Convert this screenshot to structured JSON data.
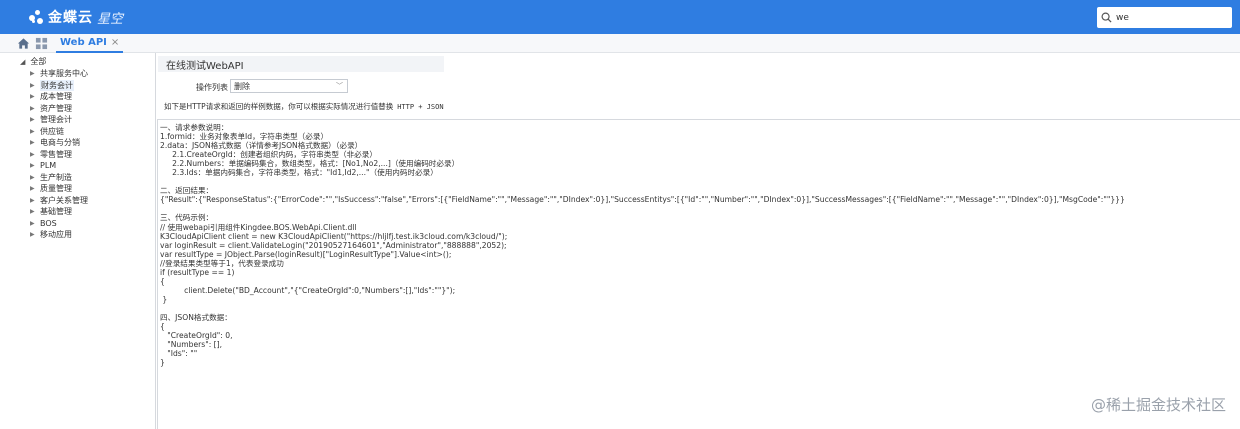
{
  "header": {
    "brand_name": "金蝶云",
    "brand_product": "星空",
    "search": {
      "value": "we"
    }
  },
  "tabs": [
    {
      "label": "Web API",
      "close": "×"
    }
  ],
  "sidebar": {
    "root": "全部",
    "items": [
      "共享服务中心",
      "财务会计",
      "成本管理",
      "资产管理",
      "管理会计",
      "供应链",
      "电商与分销",
      "零售管理",
      "PLM",
      "生产制造",
      "质量管理",
      "客户关系管理",
      "基础管理",
      "BOS",
      "移动应用"
    ],
    "selected_index": 1
  },
  "main": {
    "panel_title": "在线测试WebAPI",
    "operation_label": "操作列表",
    "operation_value": "删除",
    "hint_text": "如下是HTTP请求和返回的样例数据，你可以根据实际情况进行值替换",
    "hint_format": "HTTP + JSON",
    "doc_lines": [
      "一、请求参数说明：",
      "1.formid：业务对象表单Id，字符串类型（必录）",
      "2.data：JSON格式数据（详情参考JSON格式数据）（必录）",
      "     2.1.CreateOrgId：创建者组织内码，字符串类型（非必录）",
      "     2.2.Numbers：单据编码集合，数组类型，格式：[No1,No2,...]（使用编码时必录）",
      "     2.3.Ids：单据内码集合，字符串类型，格式：\"Id1,Id2,...\"（使用内码时必录）",
      "",
      "二、返回结果：",
      "{\"Result\":{\"ResponseStatus\":{\"ErrorCode\":\"\",\"IsSuccess\":\"false\",\"Errors\":[{\"FieldName\":\"\",\"Message\":\"\",\"DIndex\":0}],\"SuccessEntitys\":[{\"Id\":\"\",\"Number\":\"\",\"DIndex\":0}],\"SuccessMessages\":[{\"FieldName\":\"\",\"Message\":\"\",\"DIndex\":0}],\"MsgCode\":\"\"}}}",
      "",
      "三、代码示例：",
      "// 使用webapi引用组件Kingdee.BOS.WebApi.Client.dll",
      "K3CloudApiClient client = new K3CloudApiClient(\"https://hljlfj.test.ik3cloud.com/k3cloud/\");",
      "var loginResult = client.ValidateLogin(\"20190527164601\",\"Administrator\",\"888888\",2052);",
      "var resultType = JObject.Parse(loginResult)[\"LoginResultType\"].Value<int>();",
      "//登录结果类型等于1，代表登录成功",
      "if (resultType == 1)",
      "{",
      "          client.Delete(\"BD_Account\",\"{\"CreateOrgId\":0,\"Numbers\":[],\"Ids\":\"\"}\");",
      " }",
      "",
      "四、JSON格式数据：",
      "{",
      "   \"CreateOrgId\": 0,",
      "   \"Numbers\": [],",
      "   \"Ids\": \"\"",
      "}"
    ]
  },
  "watermark": "@稀土掘金技术社区",
  "colors": {
    "brand_blue": "#2f7de1",
    "tab_active": "#2f7de1",
    "panel_bg": "#f2f4f7"
  }
}
